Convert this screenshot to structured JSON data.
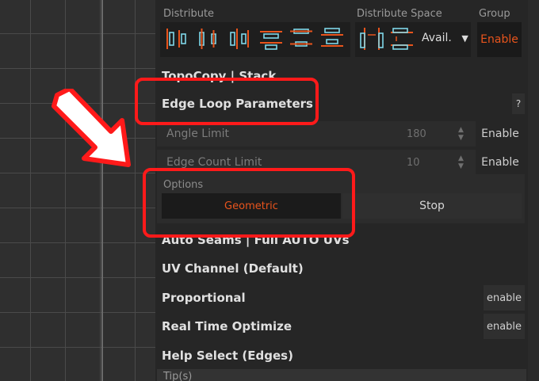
{
  "toolbar": {
    "distribute_label": "Distribute",
    "distribute_space_label": "Distribute Space",
    "group_label": "Group",
    "avail_label": "Avail.",
    "group_button": "Enable",
    "icons": [
      "align-left-icon",
      "align-center-h-icon",
      "align-right-icon",
      "align-top-icon",
      "align-middle-v-icon",
      "align-bottom-icon",
      "distribute-space-h-icon",
      "distribute-space-v-icon"
    ]
  },
  "sections": {
    "topo_copy": "TopoCopy | Stack",
    "edge_loop": "Edge Loop Parameters",
    "help_q": "?",
    "auto_seams": "Auto Seams | Full AUTO UVs",
    "uv_channel": "UV Channel (Default)",
    "proportional": "Proportional",
    "real_time": "Real Time Optimize",
    "help_select": "Help Select (Edges)",
    "tips": "Tip(s)"
  },
  "params": {
    "angle_limit": {
      "label": "Angle Limit",
      "value": "180",
      "button": "Enable"
    },
    "edge_count": {
      "label": "Edge Count Limit",
      "value": "10",
      "button": "Enable"
    }
  },
  "options": {
    "label": "Options",
    "geometric": "Geometric",
    "stop": "Stop"
  },
  "small_buttons": {
    "proportional": "enable",
    "real_time": "enable"
  },
  "colors": {
    "accent": "#e8541c",
    "annotation": "#ff1a1a",
    "icon": "#7fd8e8"
  }
}
